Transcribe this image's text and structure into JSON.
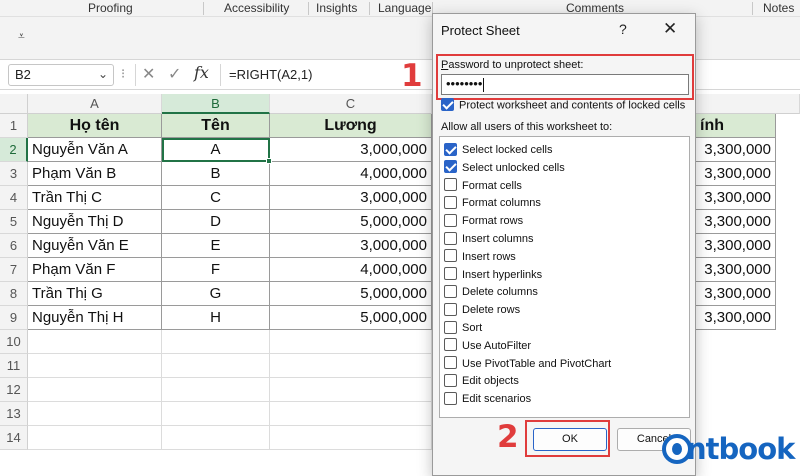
{
  "ribbon": {
    "groups": [
      "Proofing",
      "Accessibility",
      "Insights",
      "Language",
      "Comments",
      "Notes"
    ]
  },
  "formula_bar": {
    "name_box": "B2",
    "formula": "=RIGHT(A2,1)"
  },
  "sheet": {
    "column_headers": [
      "A",
      "B",
      "C"
    ],
    "row_numbers": [
      "1",
      "2",
      "3",
      "4",
      "5",
      "6",
      "7",
      "8",
      "9",
      "10",
      "11",
      "12",
      "13",
      "14"
    ],
    "header_row": [
      "Họ tên",
      "Tên",
      "Lương",
      "ính"
    ],
    "rows": [
      {
        "name": "Nguyễn Văn A",
        "ten": "A",
        "luong": "3,000,000",
        "d": "3,300,000"
      },
      {
        "name": "Phạm Văn B",
        "ten": "B",
        "luong": "4,000,000",
        "d": "3,300,000"
      },
      {
        "name": "Trần Thị C",
        "ten": "C",
        "luong": "3,000,000",
        "d": "3,300,000"
      },
      {
        "name": "Nguyễn Thị D",
        "ten": "D",
        "luong": "5,000,000",
        "d": "3,300,000"
      },
      {
        "name": "Nguyễn Văn E",
        "ten": "E",
        "luong": "3,000,000",
        "d": "3,300,000"
      },
      {
        "name": "Phạm Văn F",
        "ten": "F",
        "luong": "4,000,000",
        "d": "3,300,000"
      },
      {
        "name": "Trần Thị G",
        "ten": "G",
        "luong": "5,000,000",
        "d": "3,300,000"
      },
      {
        "name": "Nguyễn Thị H",
        "ten": "H",
        "luong": "5,000,000",
        "d": "3,300,000"
      }
    ]
  },
  "dialog": {
    "title": "Protect Sheet",
    "help": "?",
    "close": "✕",
    "password_label": "Password to unprotect sheet:",
    "password_value": "••••••••",
    "protect_label": "Protect worksheet and contents of locked cells",
    "protect_checked": true,
    "allow_label": "Allow all users of this worksheet to:",
    "permissions": [
      {
        "label": "Select locked cells",
        "checked": true
      },
      {
        "label": "Select unlocked cells",
        "checked": true
      },
      {
        "label": "Format cells",
        "checked": false
      },
      {
        "label": "Format columns",
        "checked": false
      },
      {
        "label": "Format rows",
        "checked": false
      },
      {
        "label": "Insert columns",
        "checked": false
      },
      {
        "label": "Insert rows",
        "checked": false
      },
      {
        "label": "Insert hyperlinks",
        "checked": false
      },
      {
        "label": "Delete columns",
        "checked": false
      },
      {
        "label": "Delete rows",
        "checked": false
      },
      {
        "label": "Sort",
        "checked": false
      },
      {
        "label": "Use AutoFilter",
        "checked": false
      },
      {
        "label": "Use PivotTable and PivotChart",
        "checked": false
      },
      {
        "label": "Edit objects",
        "checked": false
      },
      {
        "label": "Edit scenarios",
        "checked": false
      }
    ],
    "ok_label": "OK",
    "cancel_label": "Cancel"
  },
  "annotations": {
    "step1": "1",
    "step2": "2"
  },
  "logo": {
    "text": "ntbook"
  },
  "colors": {
    "accent_green": "#217346",
    "header_fill": "#d9ead3",
    "annotation_red": "#e03c3c",
    "checkbox_blue": "#2a64c8",
    "logo_blue": "#1565c0"
  }
}
